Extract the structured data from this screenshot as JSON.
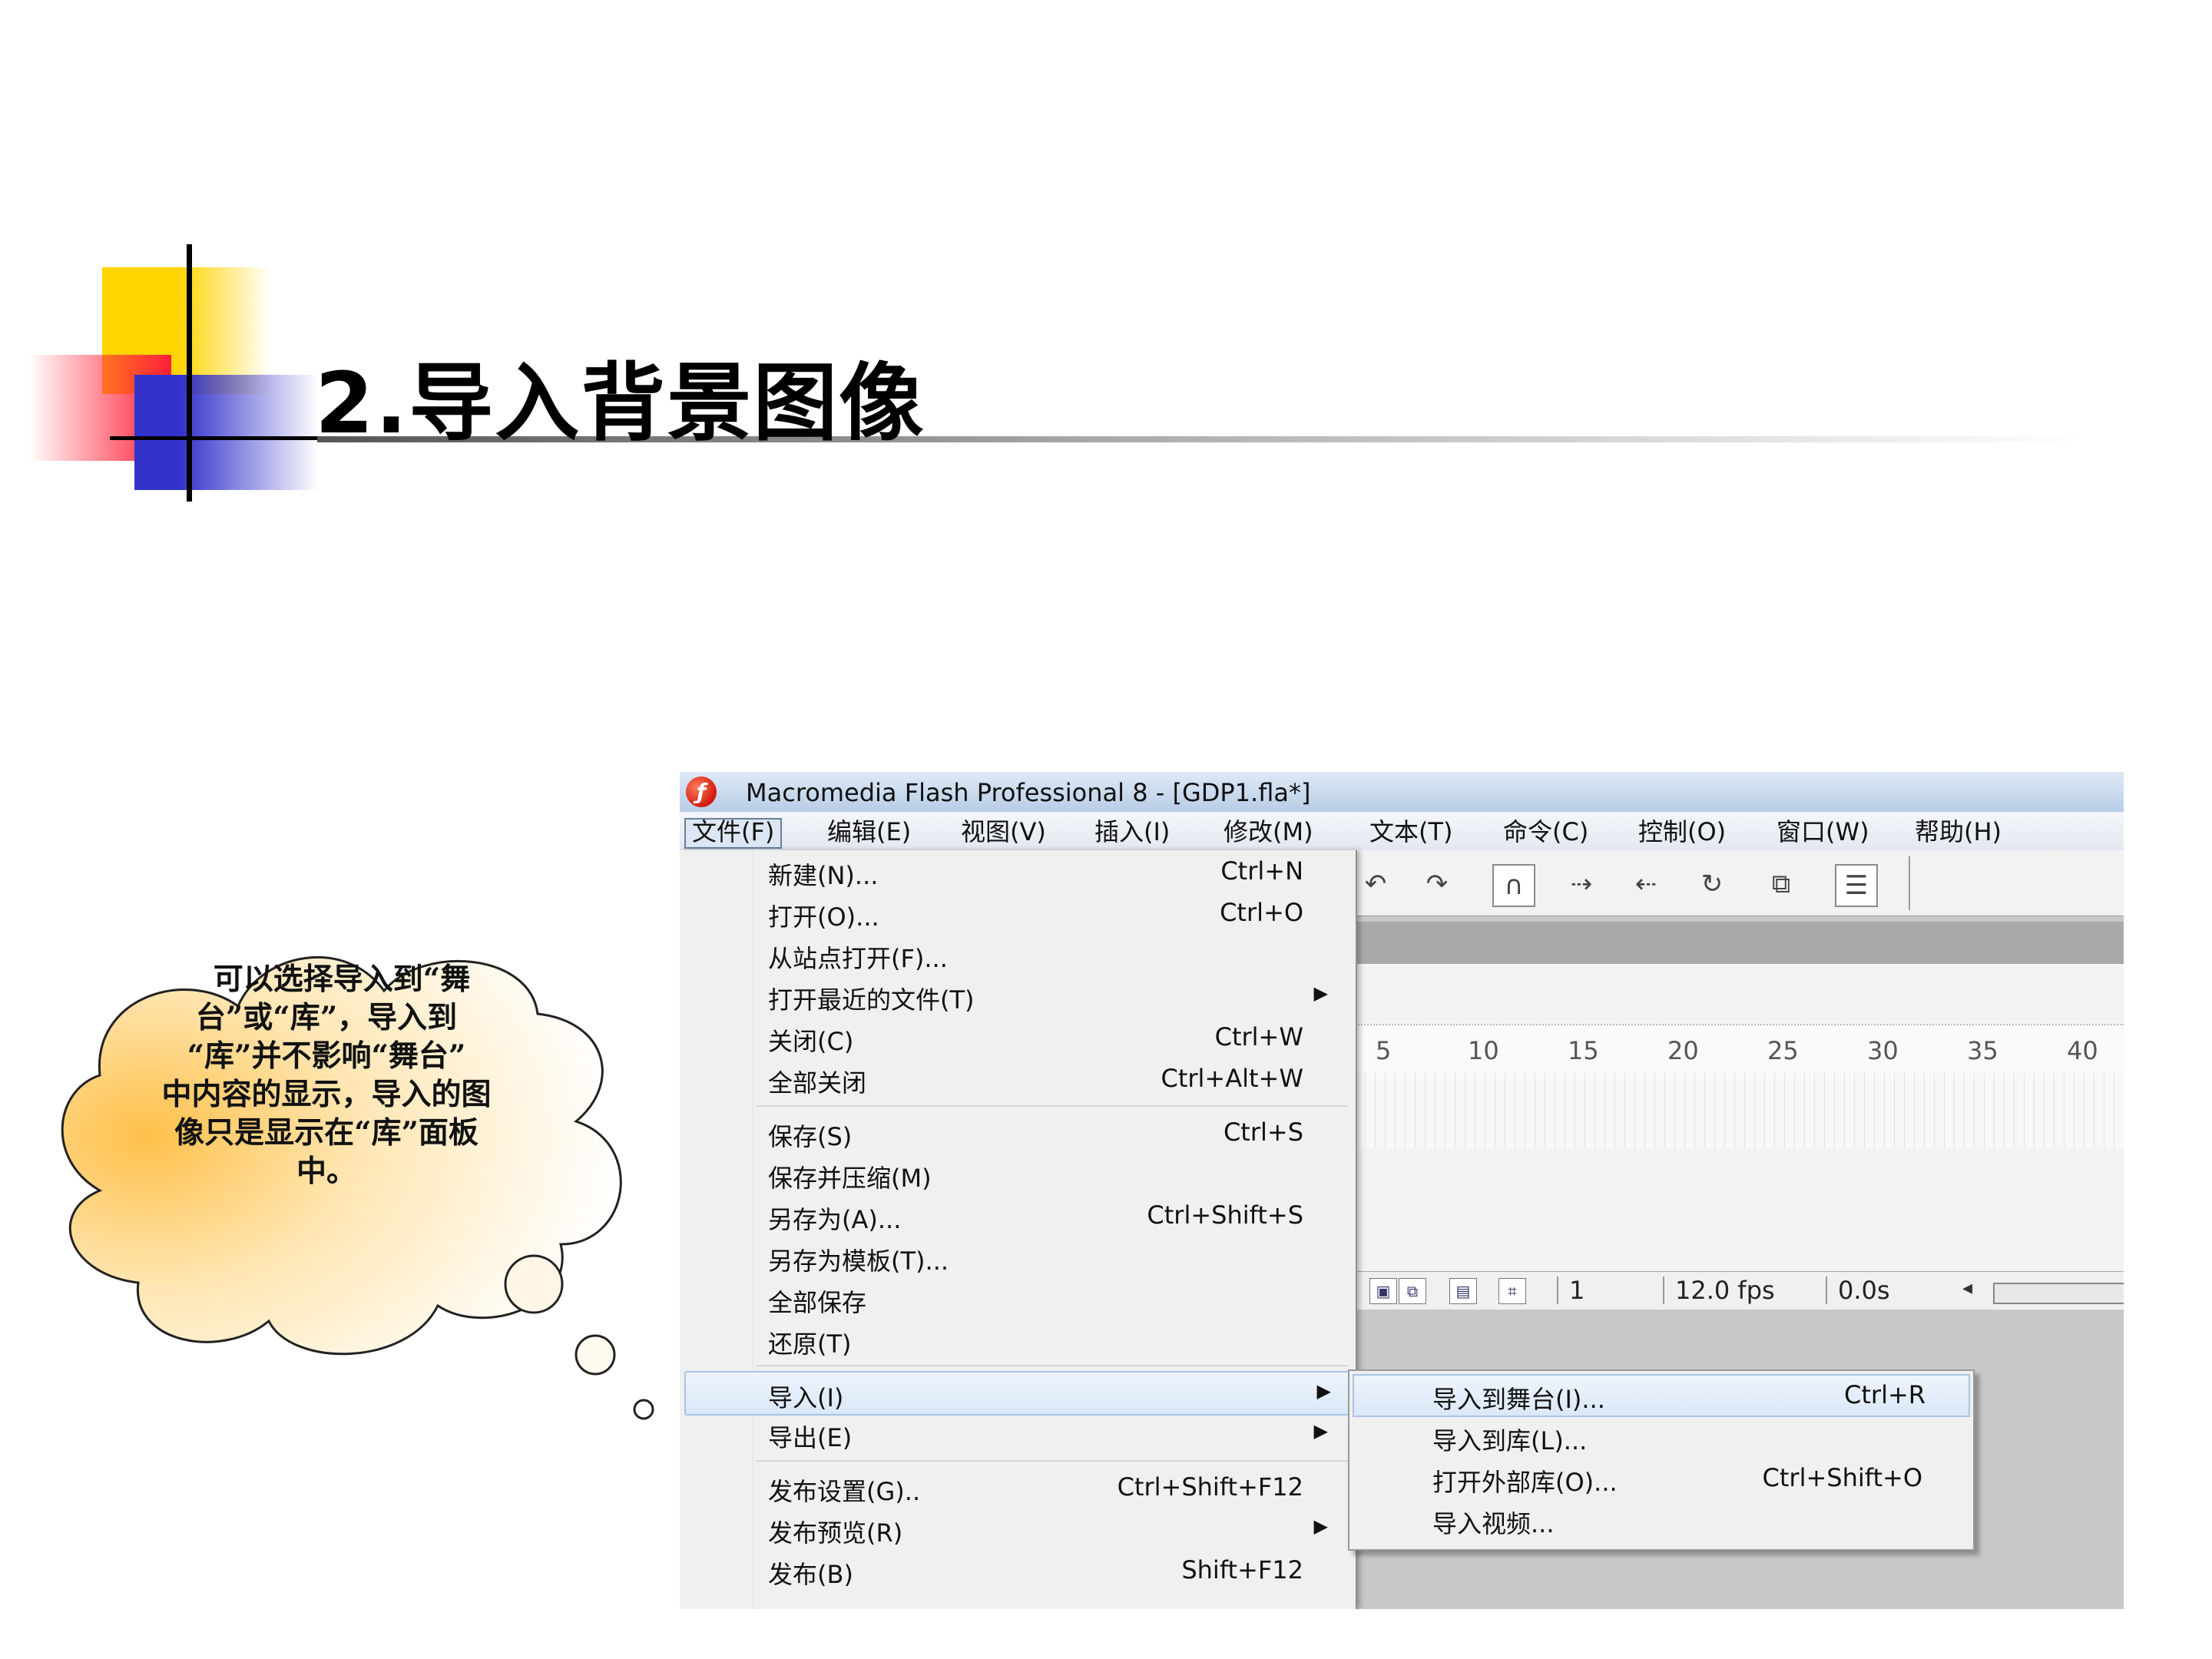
{
  "slide": {
    "title": "2.导入背景图像"
  },
  "callout": {
    "lines": [
      "可以选择导入到“舞",
      "台”或“库”，导入到",
      "“库”并不影响“舞台”",
      "中内容的显示，导入的图",
      "像只是显示在“库”面板",
      "中。"
    ]
  },
  "app": {
    "title": "Macromedia Flash Professional 8 - [GDP1.fla*]",
    "logo_glyph": "ƒ",
    "menubar": [
      {
        "label": "文件(F)",
        "active": true
      },
      {
        "label": "编辑(E)"
      },
      {
        "label": "视图(V)"
      },
      {
        "label": "插入(I)"
      },
      {
        "label": "修改(M)"
      },
      {
        "label": "文本(T)"
      },
      {
        "label": "命令(C)"
      },
      {
        "label": "控制(O)"
      },
      {
        "label": "窗口(W)"
      },
      {
        "label": "帮助(H)"
      }
    ],
    "file_menu": [
      {
        "label": "新建(N)...",
        "shortcut": "Ctrl+N"
      },
      {
        "label": "打开(O)...",
        "shortcut": "Ctrl+O"
      },
      {
        "label": "从站点打开(F)...",
        "shortcut": ""
      },
      {
        "label": "打开最近的文件(T)",
        "shortcut": "",
        "submenu": true
      },
      {
        "label": "关闭(C)",
        "shortcut": "Ctrl+W"
      },
      {
        "label": "全部关闭",
        "shortcut": "Ctrl+Alt+W"
      },
      {
        "label": "保存(S)",
        "shortcut": "Ctrl+S"
      },
      {
        "label": "保存并压缩(M)",
        "shortcut": ""
      },
      {
        "label": "另存为(A)...",
        "shortcut": "Ctrl+Shift+S"
      },
      {
        "label": "另存为模板(T)...",
        "shortcut": ""
      },
      {
        "label": "全部保存",
        "shortcut": ""
      },
      {
        "label": "还原(T)",
        "shortcut": ""
      },
      {
        "label": "导入(I)",
        "shortcut": "",
        "submenu": true,
        "highlighted": true
      },
      {
        "label": "导出(E)",
        "shortcut": "",
        "submenu": true
      },
      {
        "label": "发布设置(G)..",
        "shortcut": "Ctrl+Shift+F12"
      },
      {
        "label": "发布预览(R)",
        "shortcut": "",
        "submenu": true
      },
      {
        "label": "发布(B)",
        "shortcut": "Shift+F12"
      }
    ],
    "import_submenu": [
      {
        "label": "导入到舞台(I)...",
        "shortcut": "Ctrl+R",
        "highlighted": true
      },
      {
        "label": "导入到库(L)...",
        "shortcut": ""
      },
      {
        "label": "打开外部库(O)...",
        "shortcut": "Ctrl+Shift+O"
      },
      {
        "label": "导入视频...",
        "shortcut": ""
      }
    ],
    "toolbar_icons": [
      "undo-icon",
      "redo-icon",
      "snap-magnet-icon",
      "smooth-icon",
      "straighten-icon",
      "rotate-icon",
      "scale-icon",
      "align-icon"
    ],
    "ruler_numbers": [
      "5",
      "10",
      "15",
      "20",
      "25",
      "30",
      "35",
      "40"
    ],
    "status": {
      "current_frame": "1",
      "frame_rate": "12.0 fps",
      "elapsed_time": "0.0s"
    }
  }
}
